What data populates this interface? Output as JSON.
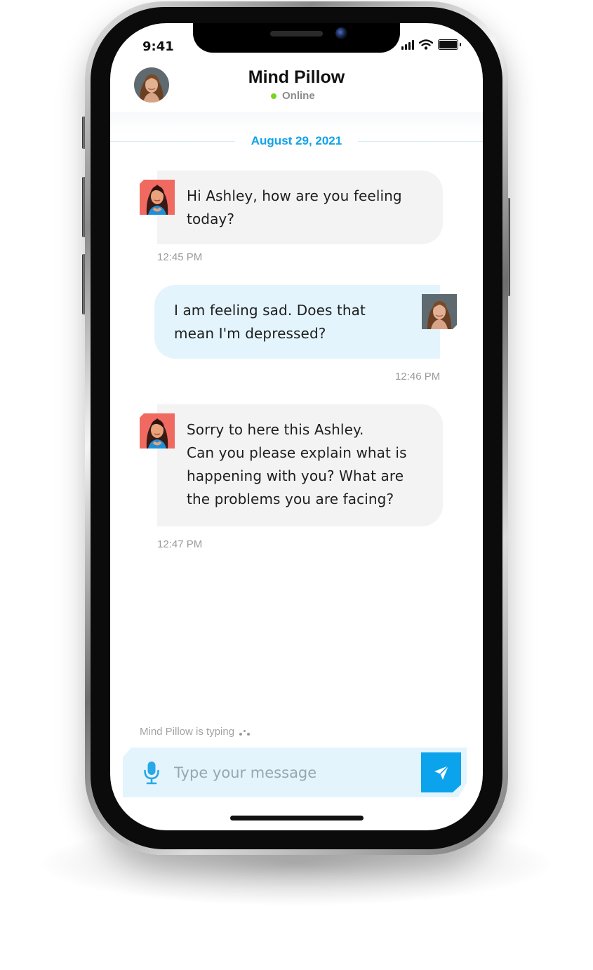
{
  "status_bar": {
    "time": "9:41",
    "icons": [
      "cellular-signal-icon",
      "wifi-icon",
      "battery-icon"
    ]
  },
  "header": {
    "title": "Mind Pillow",
    "status": "Online",
    "avatar_icon": "user-avatar-photo"
  },
  "date_divider": "August 29, 2021",
  "messages": [
    {
      "sender": "bot",
      "lines": [
        "Hi Ashley, how are you feeling",
        "today?"
      ],
      "time": "12:45 PM"
    },
    {
      "sender": "user",
      "lines": [
        "I am feeling sad. Does that",
        "mean I'm depressed?"
      ],
      "time": "12:46 PM"
    },
    {
      "sender": "bot",
      "lines": [
        "Sorry to here this Ashley.",
        "Can you please explain what is",
        "happening with you? What are",
        "the problems you are facing?"
      ],
      "time": "12:47 PM"
    }
  ],
  "typing_indicator": "Mind Pillow is typing",
  "composer": {
    "value": "",
    "placeholder": "Type your message",
    "mic_icon": "microphone-icon",
    "send_icon": "send-icon"
  },
  "colors": {
    "accent": "#0ba3ec",
    "date_text": "#10a2e8",
    "online": "#7ed321",
    "bot_bubble": "#f3f3f3",
    "user_bubble": "#e3f4fd",
    "timestamp": "#9a9a9a"
  }
}
